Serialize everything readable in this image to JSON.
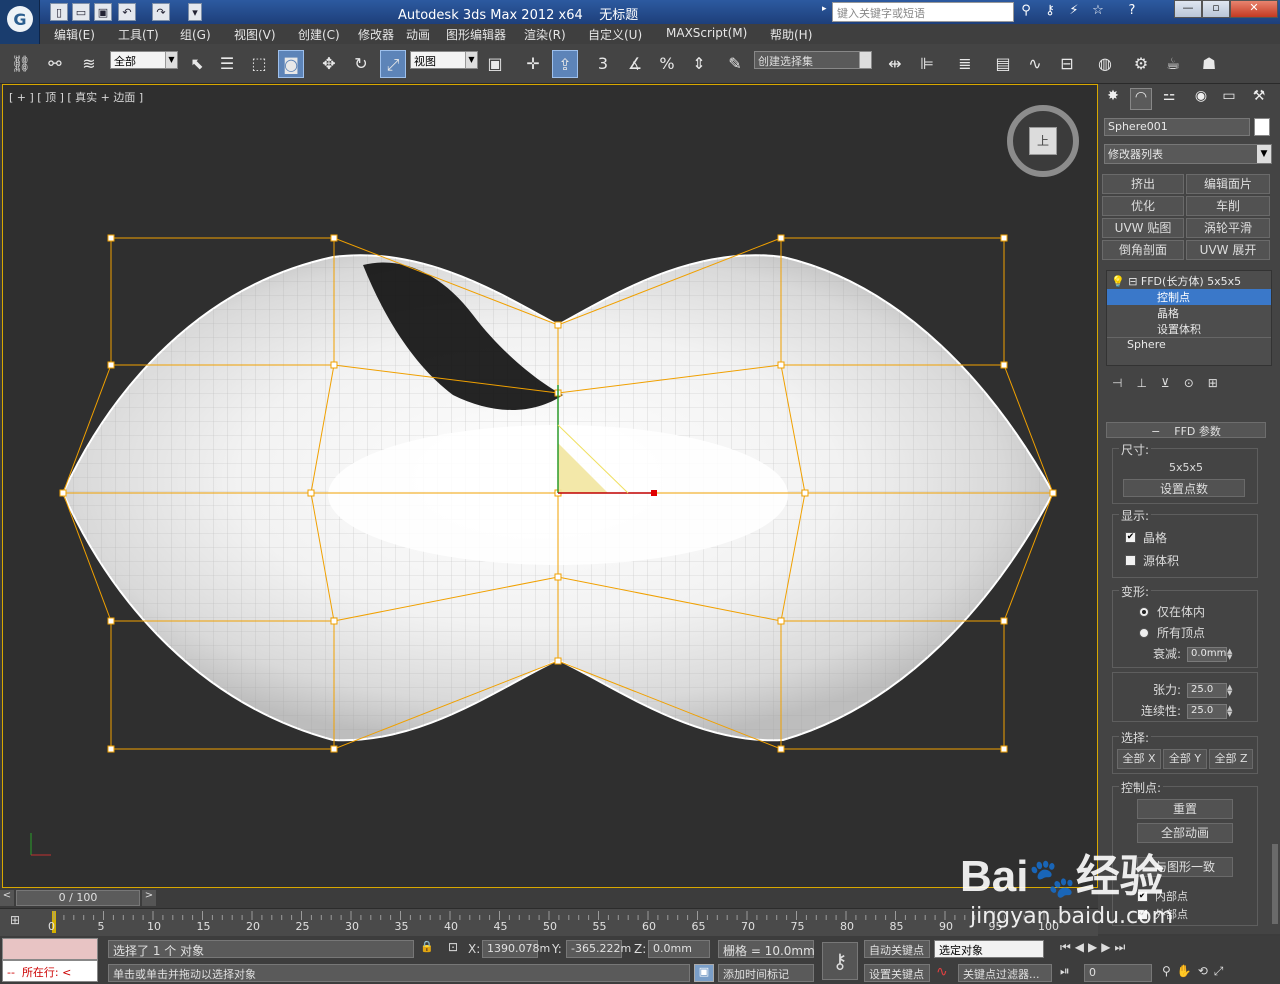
{
  "window": {
    "title": "Autodesk 3ds Max  2012 x64",
    "doc": "无标题",
    "search_placeholder": "键入关键字或短语"
  },
  "menu": [
    "编辑(E)",
    "工具(T)",
    "组(G)",
    "视图(V)",
    "创建(C)",
    "修改器",
    "动画",
    "图形编辑器",
    "渲染(R)",
    "自定义(U)",
    "MAXScript(M)",
    "帮助(H)"
  ],
  "toolbar": {
    "selection_filter": "全部",
    "ref_coord": "视图",
    "named_selection": "创建选择集",
    "snap_angle_label": "3",
    "snap_pct_label": "%"
  },
  "viewport": {
    "label": "[ + ] [ 顶 ] [ 真实 + 边面 ]",
    "viewcube_face": "上",
    "accent": "#f0a000"
  },
  "panel": {
    "object_name": "Sphere001",
    "modifier_list": "修改器列表",
    "mod_buttons": [
      "挤出",
      "编辑面片",
      "优化",
      "车削",
      "UVW 贴图",
      "涡轮平滑",
      "倒角剖面",
      "UVW 展开"
    ],
    "stack": [
      "FFD(长方体) 5x5x5",
      "控制点",
      "晶格",
      "设置体积",
      "Sphere"
    ],
    "ffd_title": "FFD 参数",
    "dim_label": "尺寸:",
    "dim_value": "5x5x5",
    "set_points": "设置点数",
    "display_label": "显示:",
    "lattice": "晶格",
    "source_volume": "源体积",
    "deform_label": "变形:",
    "only_in_volume": "仅在体内",
    "all_vertices": "所有顶点",
    "falloff_label": "衰减:",
    "falloff_value": "0.0mm",
    "tension_label": "张力:",
    "tension_value": "25.0",
    "continuity_label": "连续性:",
    "continuity_value": "25.0",
    "select_label": "选择:",
    "all_x": "全部 X",
    "all_y": "全部 Y",
    "all_z": "全部 Z",
    "cp_label": "控制点:",
    "reset": "重置",
    "animate_all": "全部动画",
    "conform": "与图形一致",
    "inner_points": "内部点",
    "outer_points": "外部点"
  },
  "timeline": {
    "position": "0 / 100",
    "ticks": [
      "0",
      "5",
      "10",
      "15",
      "20",
      "25",
      "30",
      "35",
      "40",
      "45",
      "50",
      "55",
      "60",
      "65",
      "70",
      "75",
      "80",
      "85",
      "90",
      "95",
      "100"
    ]
  },
  "status": {
    "script_prompt": "所在行:",
    "selected": "选择了 1 个 对象",
    "hint": "单击或单击并拖动以选择对象",
    "x_label": "X:",
    "x": "1390.078m",
    "y_label": "Y:",
    "y": "-365.222m",
    "z_label": "Z:",
    "z": "0.0mm",
    "grid": "栅格 = 10.0mm",
    "add_time_tag": "添加时间标记",
    "auto_key": "自动关键点",
    "set_key": "设置关键点",
    "key_mode": "选定对象",
    "key_filters": "关键点过滤器...",
    "frame": "0"
  },
  "watermark": {
    "brand": "Bai",
    "brand2": "经验",
    "url": "jingyan.baidu.com"
  }
}
